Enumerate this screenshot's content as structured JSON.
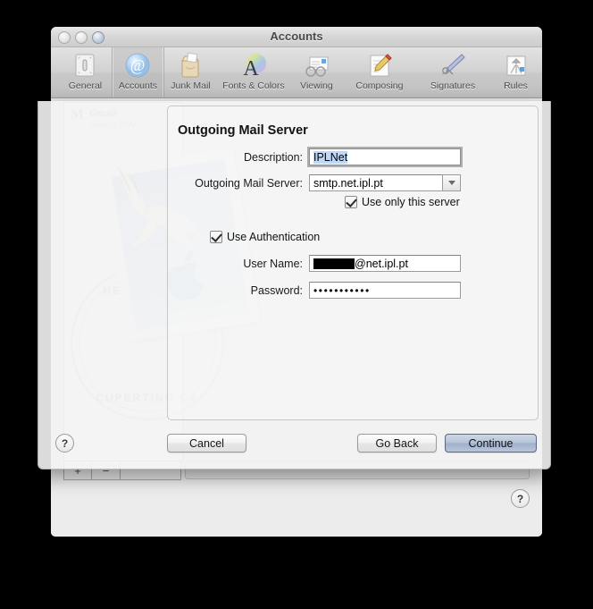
{
  "window": {
    "title": "Accounts",
    "traffic_lights": [
      "close",
      "minimize",
      "zoom"
    ]
  },
  "toolbar": {
    "items": [
      {
        "label": "General",
        "icon": "general-toggle-icon",
        "selected": false
      },
      {
        "label": "Accounts",
        "icon": "at-sign-icon",
        "selected": true
      },
      {
        "label": "Junk Mail",
        "icon": "junk-mail-bag-icon",
        "selected": false
      },
      {
        "label": "Fonts & Colors",
        "icon": "fonts-colors-icon",
        "selected": false
      },
      {
        "label": "Viewing",
        "icon": "viewing-glasses-icon",
        "selected": false
      },
      {
        "label": "Composing",
        "icon": "composing-pencil-icon",
        "selected": false
      },
      {
        "label": "Signatures",
        "icon": "signatures-pen-icon",
        "selected": false
      },
      {
        "label": "Rules",
        "icon": "rules-arrows-icon",
        "selected": false
      }
    ]
  },
  "background": {
    "account": {
      "name": "Gmail",
      "sub": "Google IMAP"
    },
    "stamp": {
      "postmark_top": "HELLO FROM",
      "postmark_bottom": "CUPERTINO CA"
    },
    "add_button": "+",
    "remove_button": "−",
    "help_button": "?"
  },
  "sheet": {
    "title": "Outgoing Mail Server",
    "fields": {
      "description": {
        "label": "Description:",
        "value": "IPLNet",
        "focused": true,
        "selected": true
      },
      "outgoing_server": {
        "label": "Outgoing Mail Server:",
        "value": "smtp.net.ipl.pt"
      },
      "user_name": {
        "label": "User Name:",
        "value_redacted": true,
        "value_suffix": "@net.ipl.pt"
      },
      "password": {
        "label": "Password:",
        "value": "•••••••••••"
      }
    },
    "checkboxes": {
      "use_only_this_server": {
        "label": "Use only this server",
        "checked": true
      },
      "use_authentication": {
        "label": "Use Authentication",
        "checked": true
      }
    },
    "buttons": {
      "help": "?",
      "cancel": "Cancel",
      "go_back": "Go Back",
      "continue": "Continue"
    }
  },
  "colors": {
    "selection_blue": "#bfd8f7",
    "default_button": "#9fb0c9",
    "window_bg": "#ececec",
    "stamp_blue": "#b7cdea"
  }
}
